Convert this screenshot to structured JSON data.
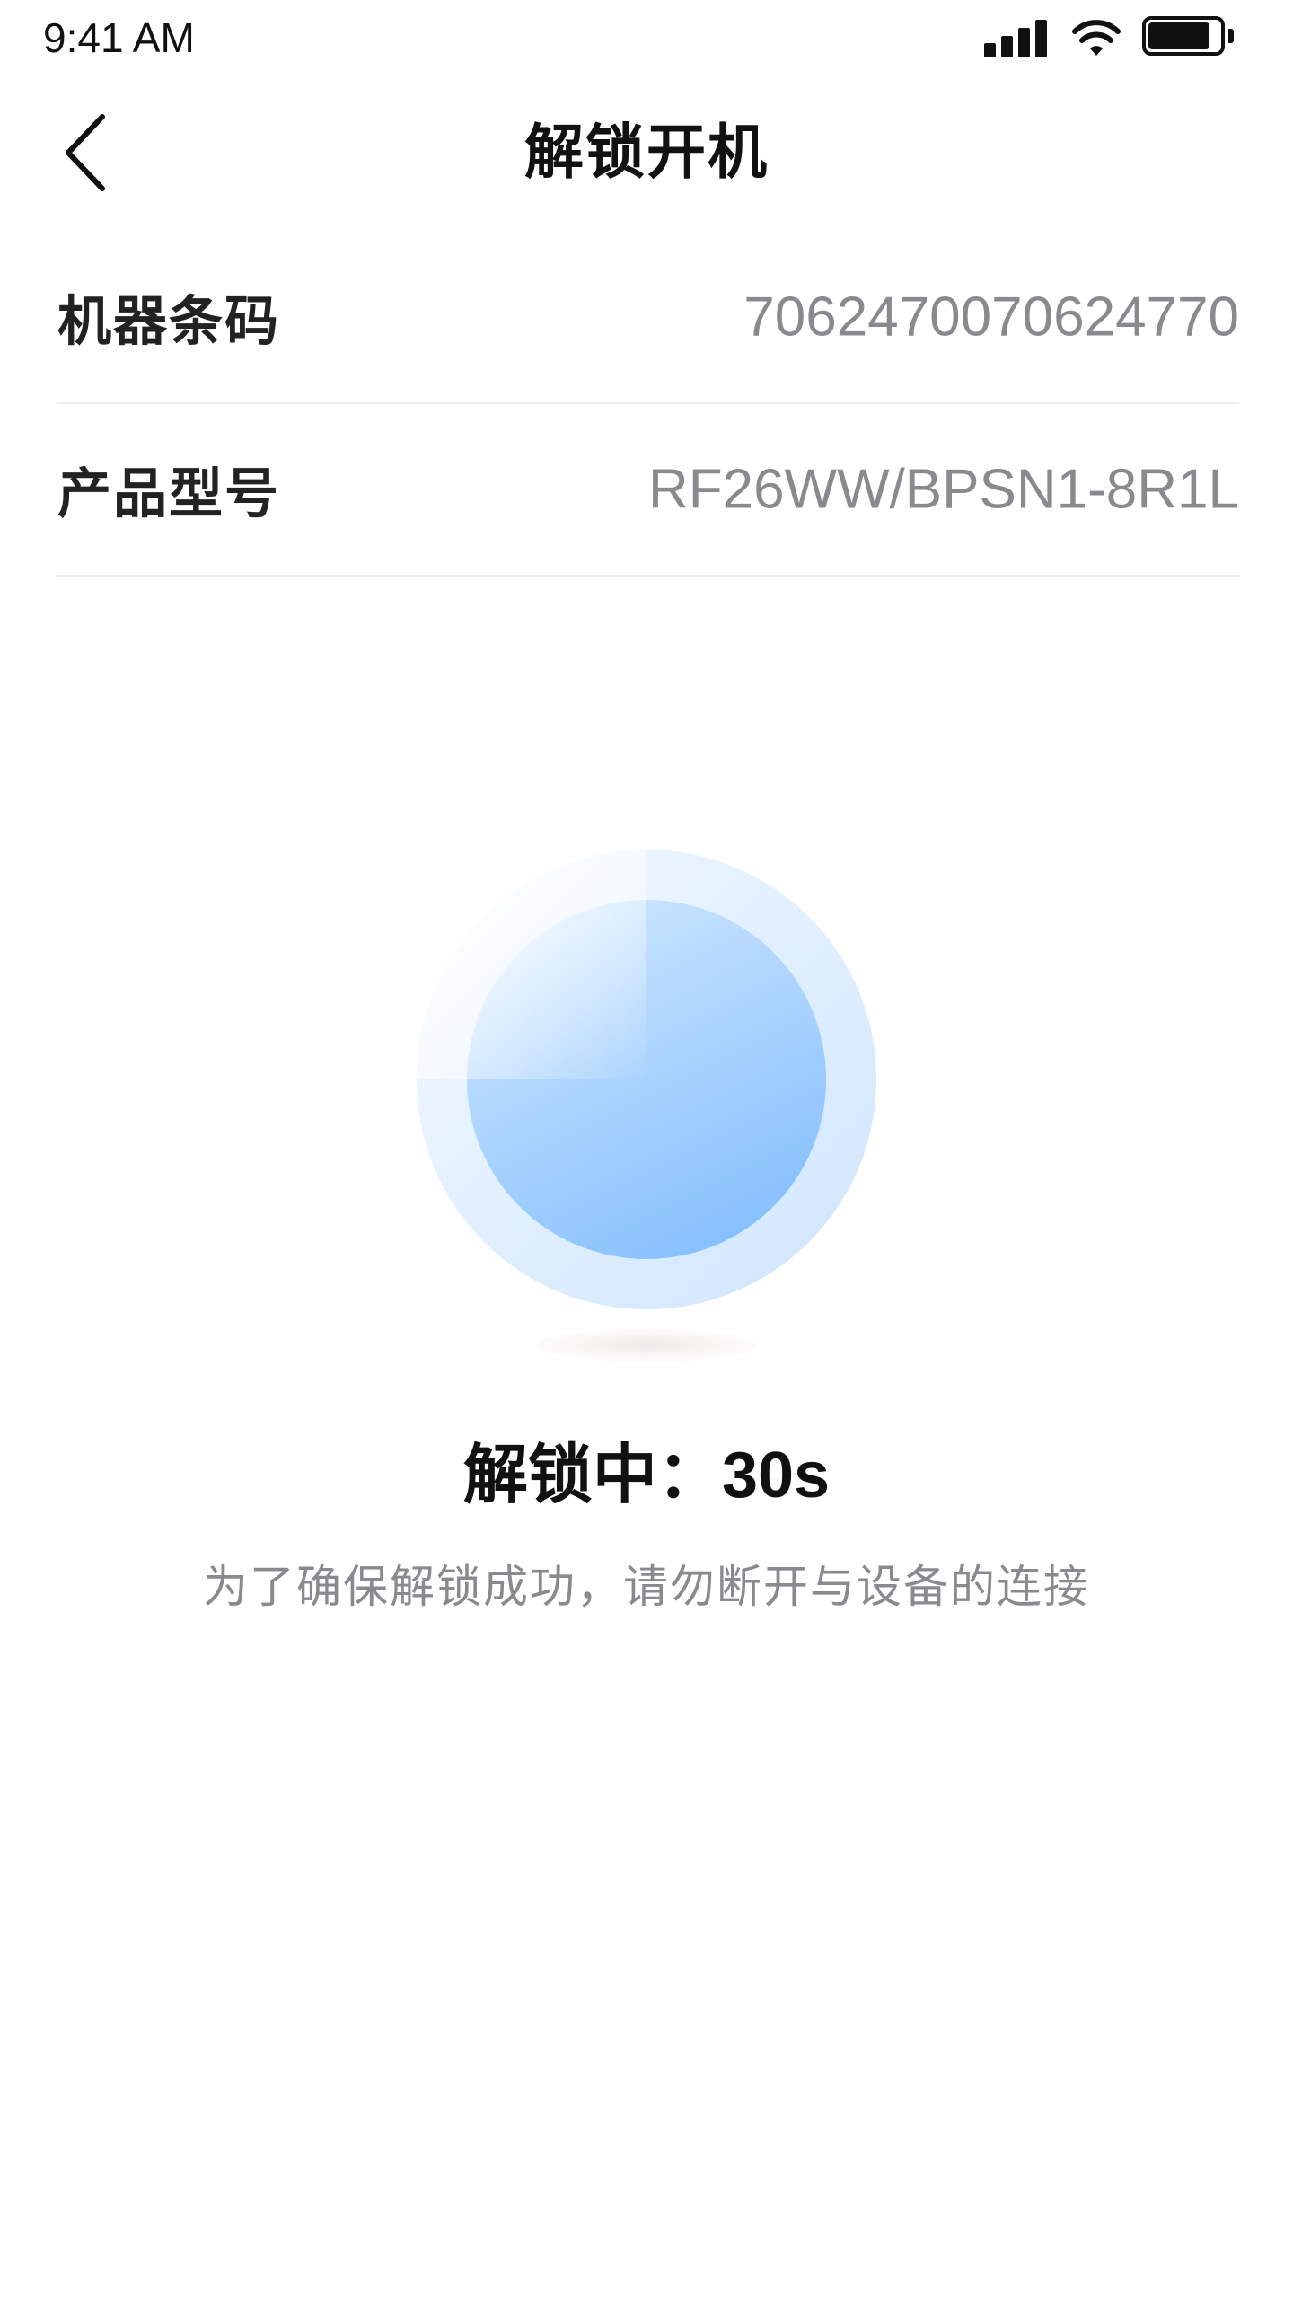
{
  "status_bar": {
    "time": "9:41 AM",
    "signal_icon": "cellular-signal-icon",
    "wifi_icon": "wifi-icon",
    "battery_icon": "battery-icon"
  },
  "header": {
    "title": "解锁开机",
    "back_icon": "chevron-left-icon"
  },
  "info": [
    {
      "label": "机器条码",
      "value": "7062470070624770"
    },
    {
      "label": "产品型号",
      "value": "RF26WW/BPSN1-8R1L"
    }
  ],
  "progress": {
    "status_label": "解锁中：",
    "remaining": "30s",
    "hint": "为了确保解锁成功，请勿断开与设备的连接"
  },
  "colors": {
    "accent_light": "#e6f3ff",
    "accent": "#8ec5ff",
    "text_primary": "#111111",
    "text_secondary": "#8a8a8e",
    "divider": "#ececec"
  }
}
